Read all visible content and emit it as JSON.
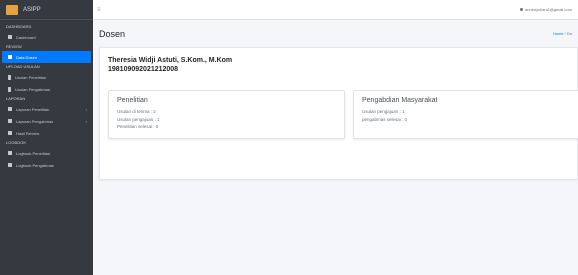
{
  "app": {
    "name": "ASIPP"
  },
  "sidebar": {
    "header_dashboard": "DASHBOARD",
    "dashboard": "Dashboard",
    "header_review": "REVIEW",
    "data_dosen": "Data Dosen",
    "header_upload": "Upload Usulan",
    "usulan_penelitian": "Usulan Penelitian",
    "usulan_pengabmas": "Usulan Pengabmas",
    "header_laporan": "LAPORAN",
    "laporan_penelitian": "Laporan Penelitian",
    "laporan_pengabmas": "Laporan Pengabmas",
    "hasil_review": "Hasil Review",
    "header_logbook": "LOGBOOK",
    "logbook_penelitian": "Logbook Penelitian",
    "logbook_pengabmas": "Logbook Pengabmas"
  },
  "topbar": {
    "user_email": "anneoyuliani2@gmail.com"
  },
  "page": {
    "title": "Dosen",
    "breadcrumb_home": "Home",
    "breadcrumb_sep": "/",
    "breadcrumb_current": "Do"
  },
  "lecturer": {
    "name": "Theresia Widji Astuti, S.Kom., M.Kom",
    "id": "198109092021212008"
  },
  "penelitian": {
    "title": "Penelitian",
    "usulan_diterima": "Usulan di terima : 2",
    "usulan_pengajuan": "Usulan pengajuan : 1",
    "penelitian_selesai": "Penelitian selesai : 0"
  },
  "pengabdian": {
    "title": "Pengabdian Masyarakat",
    "usulan_pengajuan": "Usulan pengajuan : 1",
    "pengabmas_selesai": "pengabmas selesai : 0"
  }
}
